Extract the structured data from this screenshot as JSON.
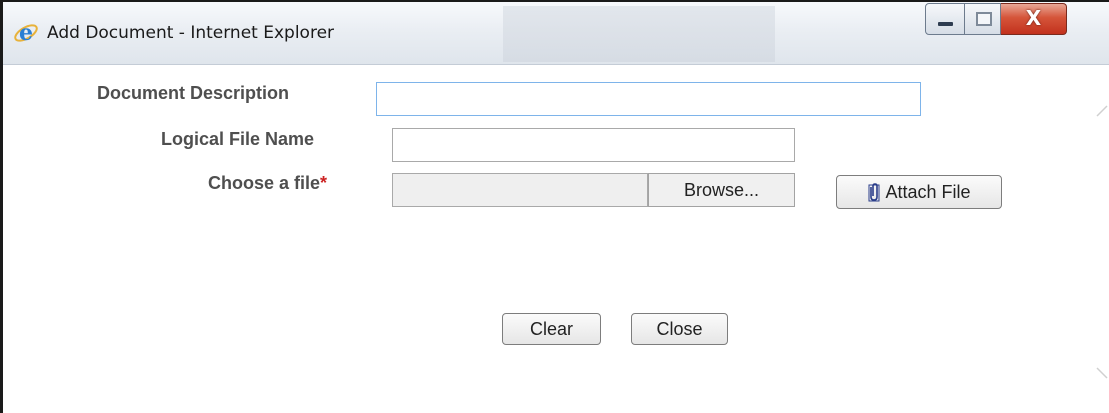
{
  "window": {
    "title": "Add Document - Internet Explorer",
    "app_icon": "internet-explorer-icon",
    "controls": {
      "minimize": "minimize-icon",
      "maximize": "maximize-icon",
      "close": "X"
    }
  },
  "form": {
    "description_label": "Document Description",
    "description_value": "",
    "logical_name_label": "Logical File Name",
    "logical_name_value": "",
    "file_label": "Choose a file",
    "required_marker": "*",
    "file_value": "",
    "browse_label": "Browse...",
    "attach_label": "Attach File",
    "attach_icon": "paperclip-icon"
  },
  "actions": {
    "clear_label": "Clear",
    "close_label": "Close"
  },
  "colors": {
    "required": "#cc2222",
    "focus_border": "#7eb4ea",
    "close_button": "#c2311d"
  }
}
